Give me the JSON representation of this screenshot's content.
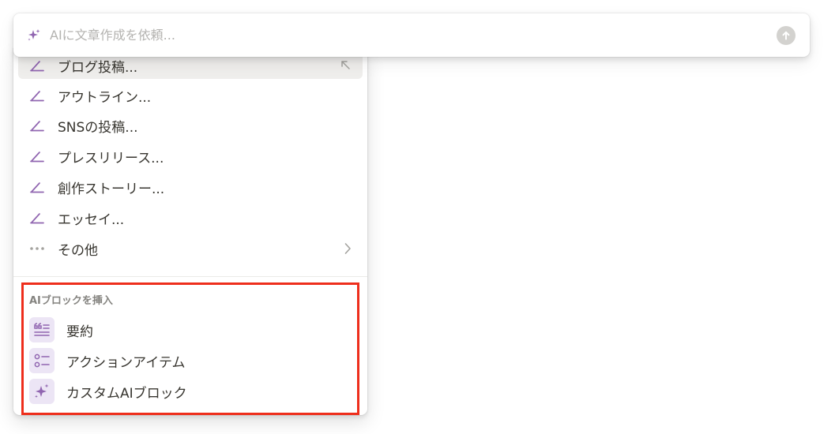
{
  "prompt": {
    "placeholder": "AIに文章作成を依頼...",
    "value": ""
  },
  "menu": {
    "write_items": [
      {
        "label": "ブログ投稿...",
        "icon": "pen-line-icon"
      },
      {
        "label": "アウトライン...",
        "icon": "pen-line-icon"
      },
      {
        "label": "SNSの投稿...",
        "icon": "pen-line-icon"
      },
      {
        "label": "プレスリリース...",
        "icon": "pen-line-icon"
      },
      {
        "label": "創作ストーリー...",
        "icon": "pen-line-icon"
      },
      {
        "label": "エッセイ...",
        "icon": "pen-line-icon"
      }
    ],
    "more": {
      "label": "その他",
      "icon": "ellipsis-icon"
    },
    "ai_blocks": {
      "heading": "AIブロックを挿入",
      "items": [
        {
          "label": "要約",
          "icon": "summary-quote-icon"
        },
        {
          "label": "アクションアイテム",
          "icon": "checklist-icon"
        },
        {
          "label": "カスタムAIブロック",
          "icon": "sparkle-icon"
        }
      ]
    }
  },
  "colors": {
    "accent_purple": "#9065b0",
    "icon_bg_purple": "#ece5f5",
    "highlight_red": "#ee2e1c",
    "hover_bg": "#efeeec"
  }
}
